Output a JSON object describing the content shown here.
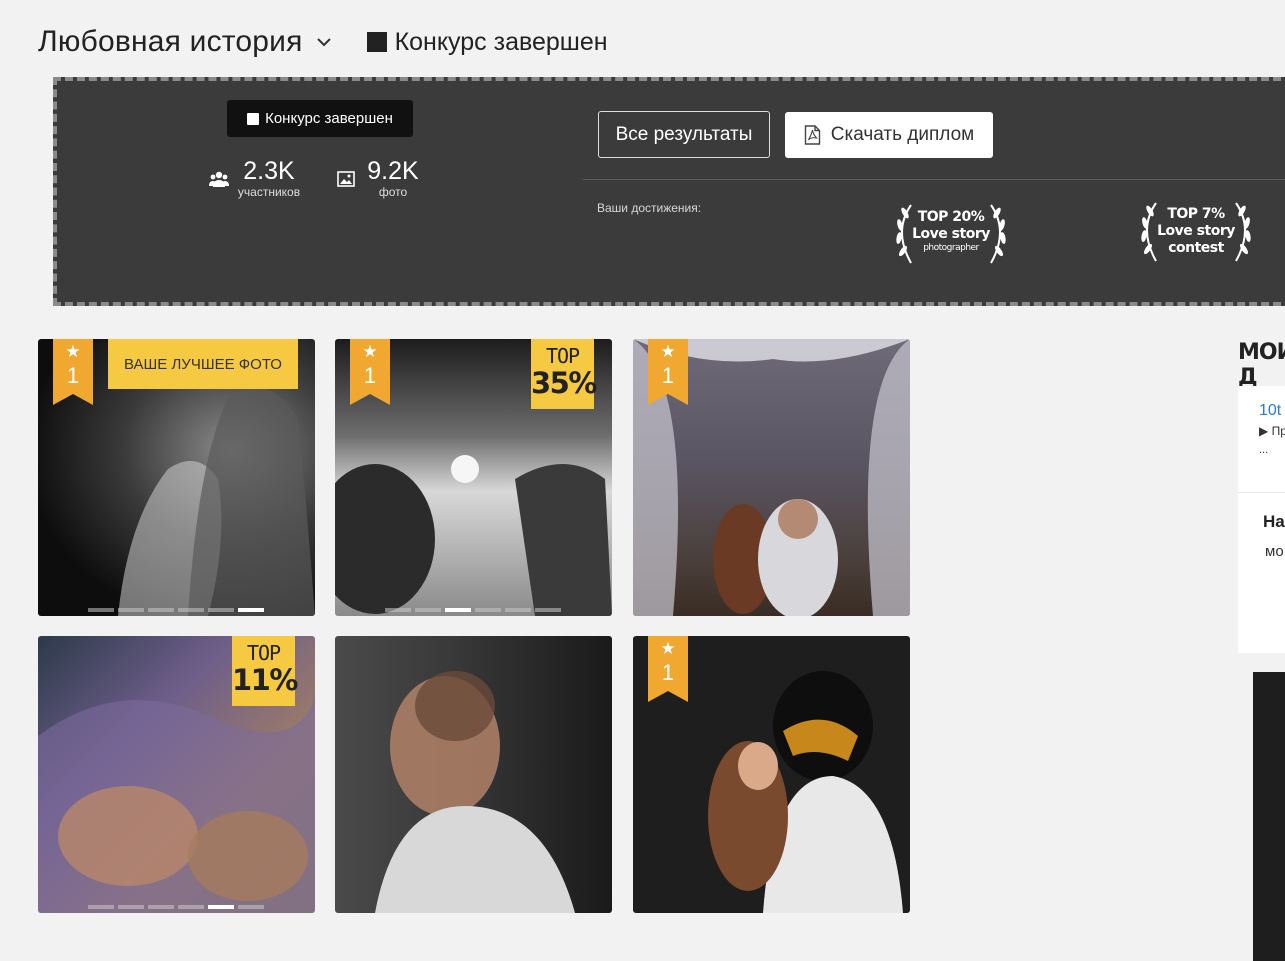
{
  "header": {
    "contest_title": "Любовная история",
    "status": "Конкурс завершен"
  },
  "panel": {
    "badge": "Конкурс завершен",
    "participants": {
      "value": "2.3K",
      "label": "участников",
      "icon": "users-icon"
    },
    "photos": {
      "value": "9.2K",
      "label": "фото",
      "icon": "image-icon"
    },
    "all_results_button": "Все результаты",
    "download_diploma_button": "Скачать диплом",
    "achievements_label": "Ваши достижения:",
    "achievements": [
      {
        "line1": "TOP 20%",
        "line2": "Love story",
        "line3": "photographer"
      },
      {
        "line1": "TOP 7%",
        "line2": "Love story",
        "line3": "contest"
      }
    ]
  },
  "photos": [
    {
      "ribbon": "1",
      "best_label": "ВАШЕ ЛУЧШЕЕ ФОТО",
      "slides": 6,
      "active_slide": 6
    },
    {
      "ribbon": "1",
      "top_label": "TOP",
      "top_value": "35%",
      "slides": 6,
      "active_slide": 3
    },
    {
      "ribbon": "1"
    },
    {
      "top_label": "TOP",
      "top_value": "11%",
      "slides": 6,
      "active_slide": 5
    },
    {},
    {
      "ribbon": "1"
    }
  ],
  "sidebar": {
    "title": "МОИ Д",
    "link": "10t",
    "sub": "▶ Пр",
    "dots": "...",
    "heading": "На",
    "text": "мо"
  },
  "colors": {
    "ribbon": "#f0a830",
    "top_tag": "#f6c942",
    "panel": "#3b3b3b",
    "link": "#2a7bd5"
  }
}
